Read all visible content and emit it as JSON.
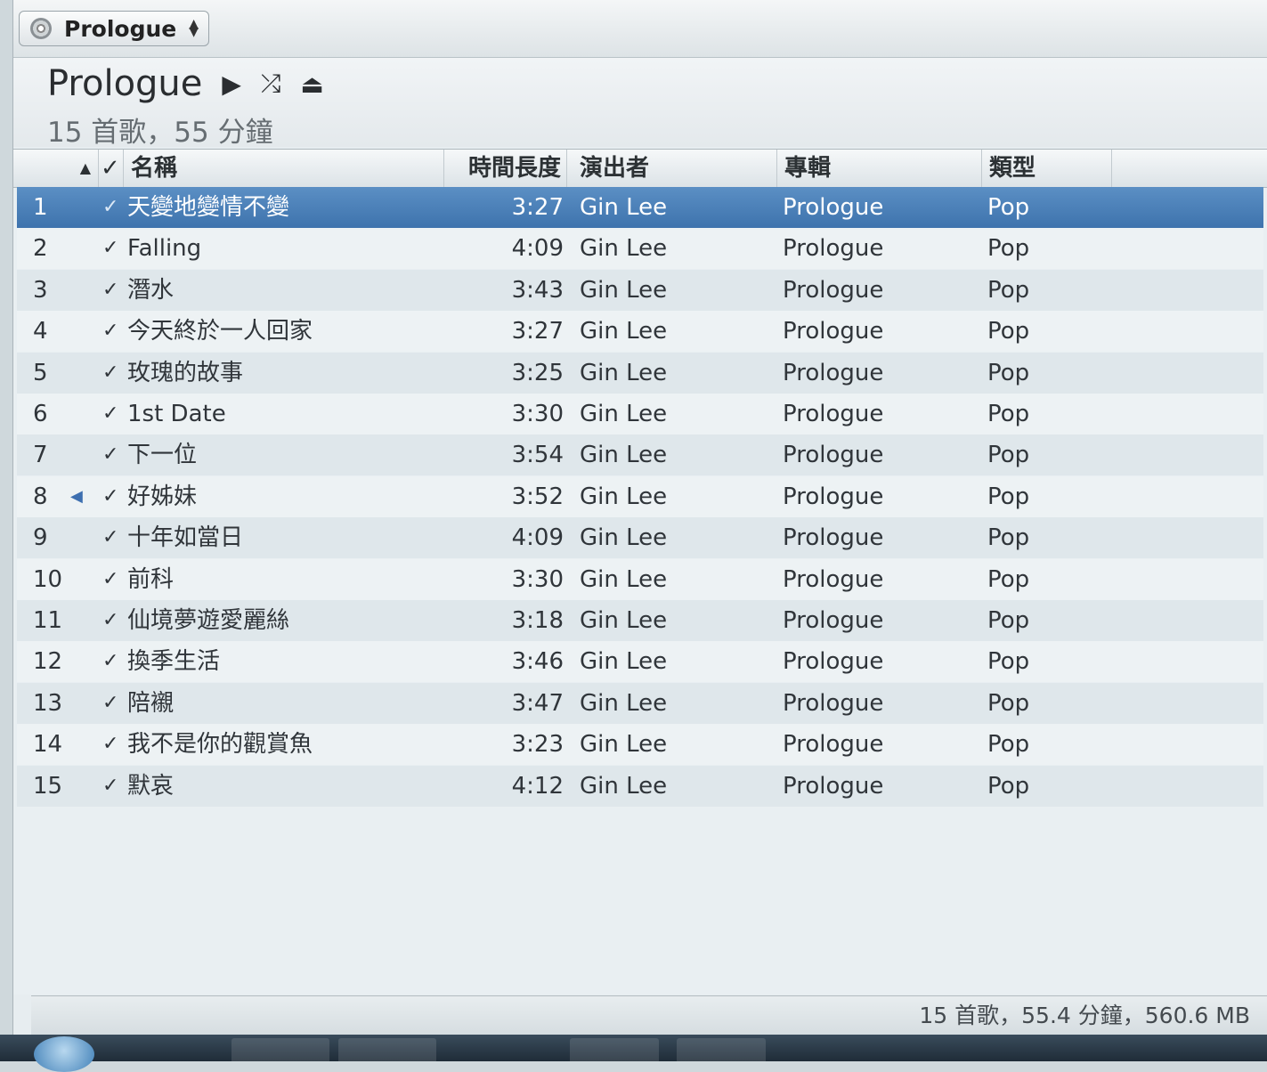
{
  "selector": {
    "label": "Prologue",
    "icon": "disc-icon"
  },
  "header": {
    "title": "Prologue",
    "subtitle": "15 首歌，55 分鐘",
    "controls": {
      "play": "▶",
      "shuffle": "⤮",
      "eject": "⏏"
    }
  },
  "columns": {
    "sort_indicator": "▲",
    "check": "✓",
    "name": "名稱",
    "time": "時間長度",
    "artist": "演出者",
    "album": "專輯",
    "genre": "類型"
  },
  "tracks": [
    {
      "num": "1",
      "name": "天變地變情不變",
      "time": "3:27",
      "artist": "Gin Lee",
      "album": "Prologue",
      "genre": "Pop",
      "selected": true
    },
    {
      "num": "2",
      "name": "Falling",
      "time": "4:09",
      "artist": "Gin Lee",
      "album": "Prologue",
      "genre": "Pop"
    },
    {
      "num": "3",
      "name": "潛水",
      "time": "3:43",
      "artist": "Gin Lee",
      "album": "Prologue",
      "genre": "Pop"
    },
    {
      "num": "4",
      "name": "今天終於一人回家",
      "time": "3:27",
      "artist": "Gin Lee",
      "album": "Prologue",
      "genre": "Pop"
    },
    {
      "num": "5",
      "name": "玫瑰的故事",
      "time": "3:25",
      "artist": "Gin Lee",
      "album": "Prologue",
      "genre": "Pop"
    },
    {
      "num": "6",
      "name": "1st Date",
      "time": "3:30",
      "artist": "Gin Lee",
      "album": "Prologue",
      "genre": "Pop"
    },
    {
      "num": "7",
      "name": "下一位",
      "time": "3:54",
      "artist": "Gin Lee",
      "album": "Prologue",
      "genre": "Pop"
    },
    {
      "num": "8",
      "name": "好姊妹",
      "time": "3:52",
      "artist": "Gin Lee",
      "album": "Prologue",
      "genre": "Pop",
      "playing": true
    },
    {
      "num": "9",
      "name": "十年如當日",
      "time": "4:09",
      "artist": "Gin Lee",
      "album": "Prologue",
      "genre": "Pop"
    },
    {
      "num": "10",
      "name": "前科",
      "time": "3:30",
      "artist": "Gin Lee",
      "album": "Prologue",
      "genre": "Pop"
    },
    {
      "num": "11",
      "name": "仙境夢遊愛麗絲",
      "time": "3:18",
      "artist": "Gin Lee",
      "album": "Prologue",
      "genre": "Pop"
    },
    {
      "num": "12",
      "name": "換季生活",
      "time": "3:46",
      "artist": "Gin Lee",
      "album": "Prologue",
      "genre": "Pop"
    },
    {
      "num": "13",
      "name": "陪襯",
      "time": "3:47",
      "artist": "Gin Lee",
      "album": "Prologue",
      "genre": "Pop"
    },
    {
      "num": "14",
      "name": "我不是你的觀賞魚",
      "time": "3:23",
      "artist": "Gin Lee",
      "album": "Prologue",
      "genre": "Pop"
    },
    {
      "num": "15",
      "name": "默哀",
      "time": "4:12",
      "artist": "Gin Lee",
      "album": "Prologue",
      "genre": "Pop"
    }
  ],
  "status": "15 首歌，55.4 分鐘，560.6 MB",
  "colors": {
    "selection": "#4a80b9",
    "row_odd": "#dfe7eb",
    "row_even": "#edf2f4"
  }
}
